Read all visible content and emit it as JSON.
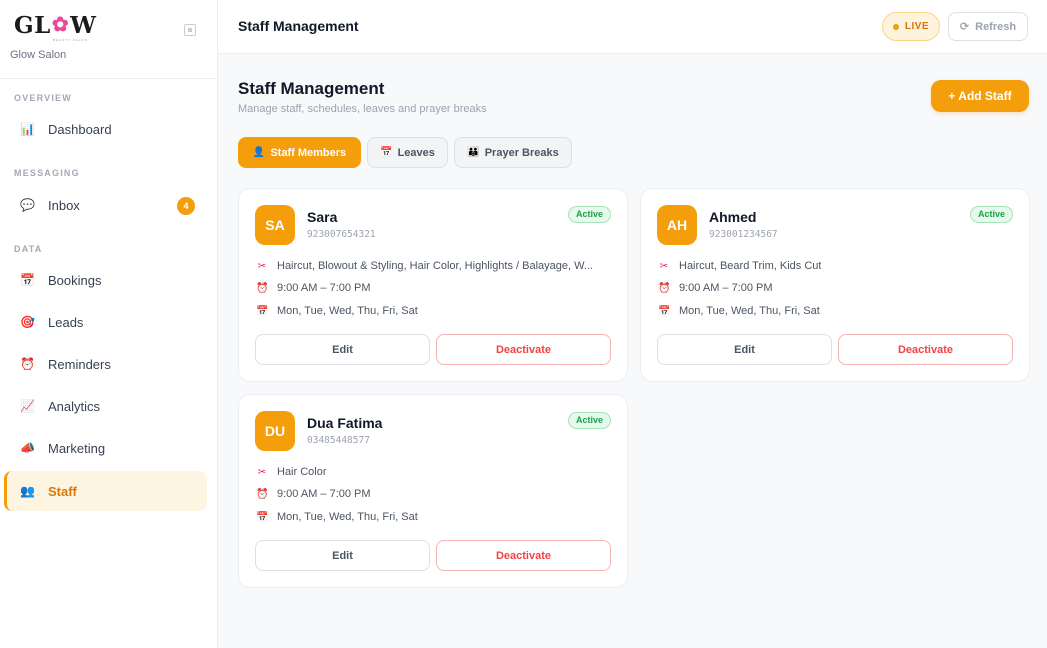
{
  "brand": {
    "logo_left": "GL",
    "logo_right": "W",
    "logo_sub": "BEAUTY SALON",
    "salon_name": "Glow Salon"
  },
  "sidebar": {
    "sections": [
      {
        "label": "OVERVIEW"
      },
      {
        "label": "MESSAGING"
      },
      {
        "label": "DATA"
      }
    ],
    "items": [
      {
        "label": "Dashboard",
        "icon": "bar-chart-icon"
      },
      {
        "label": "Inbox",
        "icon": "speech-bubble-icon",
        "badge": "4"
      },
      {
        "label": "Bookings",
        "icon": "calendar-icon"
      },
      {
        "label": "Leads",
        "icon": "target-icon"
      },
      {
        "label": "Reminders",
        "icon": "alarm-clock-icon"
      },
      {
        "label": "Analytics",
        "icon": "line-chart-icon"
      },
      {
        "label": "Marketing",
        "icon": "megaphone-icon"
      },
      {
        "label": "Staff",
        "icon": "users-icon",
        "active": true
      }
    ]
  },
  "topbar": {
    "title": "Staff Management",
    "live_label": "LIVE",
    "refresh_label": "Refresh"
  },
  "main": {
    "title": "Staff Management",
    "subtitle": "Manage staff, schedules, leaves and prayer breaks",
    "add_label": "+ Add Staff",
    "tabs": [
      {
        "label": "Staff Members",
        "icon": "person-icon",
        "active": true
      },
      {
        "label": "Leaves",
        "icon": "calendar-icon"
      },
      {
        "label": "Prayer Breaks",
        "icon": "group-icon"
      }
    ]
  },
  "staff": [
    {
      "initials": "SA",
      "name": "Sara",
      "phone": "923007654321",
      "status": "Active",
      "services": "Haircut, Blowout & Styling, Hair Color, Highlights / Balayage, W...",
      "hours": "9:00 AM – 7:00 PM",
      "days": "Mon, Tue, Wed, Thu, Fri, Sat",
      "edit_label": "Edit",
      "deactivate_label": "Deactivate"
    },
    {
      "initials": "AH",
      "name": "Ahmed",
      "phone": "923001234567",
      "status": "Active",
      "services": "Haircut, Beard Trim, Kids Cut",
      "hours": "9:00 AM – 7:00 PM",
      "days": "Mon, Tue, Wed, Thu, Fri, Sat",
      "edit_label": "Edit",
      "deactivate_label": "Deactivate"
    },
    {
      "initials": "DU",
      "name": "Dua Fatima",
      "phone": "03485448577",
      "status": "Active",
      "services": "Hair Color",
      "hours": "9:00 AM – 7:00 PM",
      "days": "Mon, Tue, Wed, Thu, Fri, Sat",
      "edit_label": "Edit",
      "deactivate_label": "Deactivate"
    }
  ],
  "colors": {
    "accent": "#f59e0b",
    "accent_dark": "#d97706",
    "active_green": "#16a34a",
    "danger": "#ef4444"
  }
}
